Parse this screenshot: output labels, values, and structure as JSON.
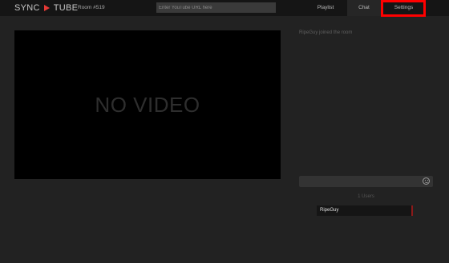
{
  "header": {
    "logo_left": "SYNC",
    "logo_right": "TUBE",
    "room": "Room #519",
    "url_placeholder": "Enter YouTube URL here",
    "tabs": [
      {
        "label": "Playlist"
      },
      {
        "label": "Chat"
      },
      {
        "label": "Settings"
      }
    ]
  },
  "video": {
    "placeholder": "NO VIDEO"
  },
  "chat": {
    "messages": [
      {
        "text": "RipeGuy joined the room"
      }
    ],
    "input_value": "",
    "emoji_icon": "smiley-icon"
  },
  "users": {
    "count_label": "1 Users",
    "list": [
      {
        "name": "RipeGuy"
      }
    ]
  },
  "colors": {
    "accent": "#e53935",
    "highlight": "#ff0000",
    "background": "#222222",
    "topbar": "#151515"
  }
}
